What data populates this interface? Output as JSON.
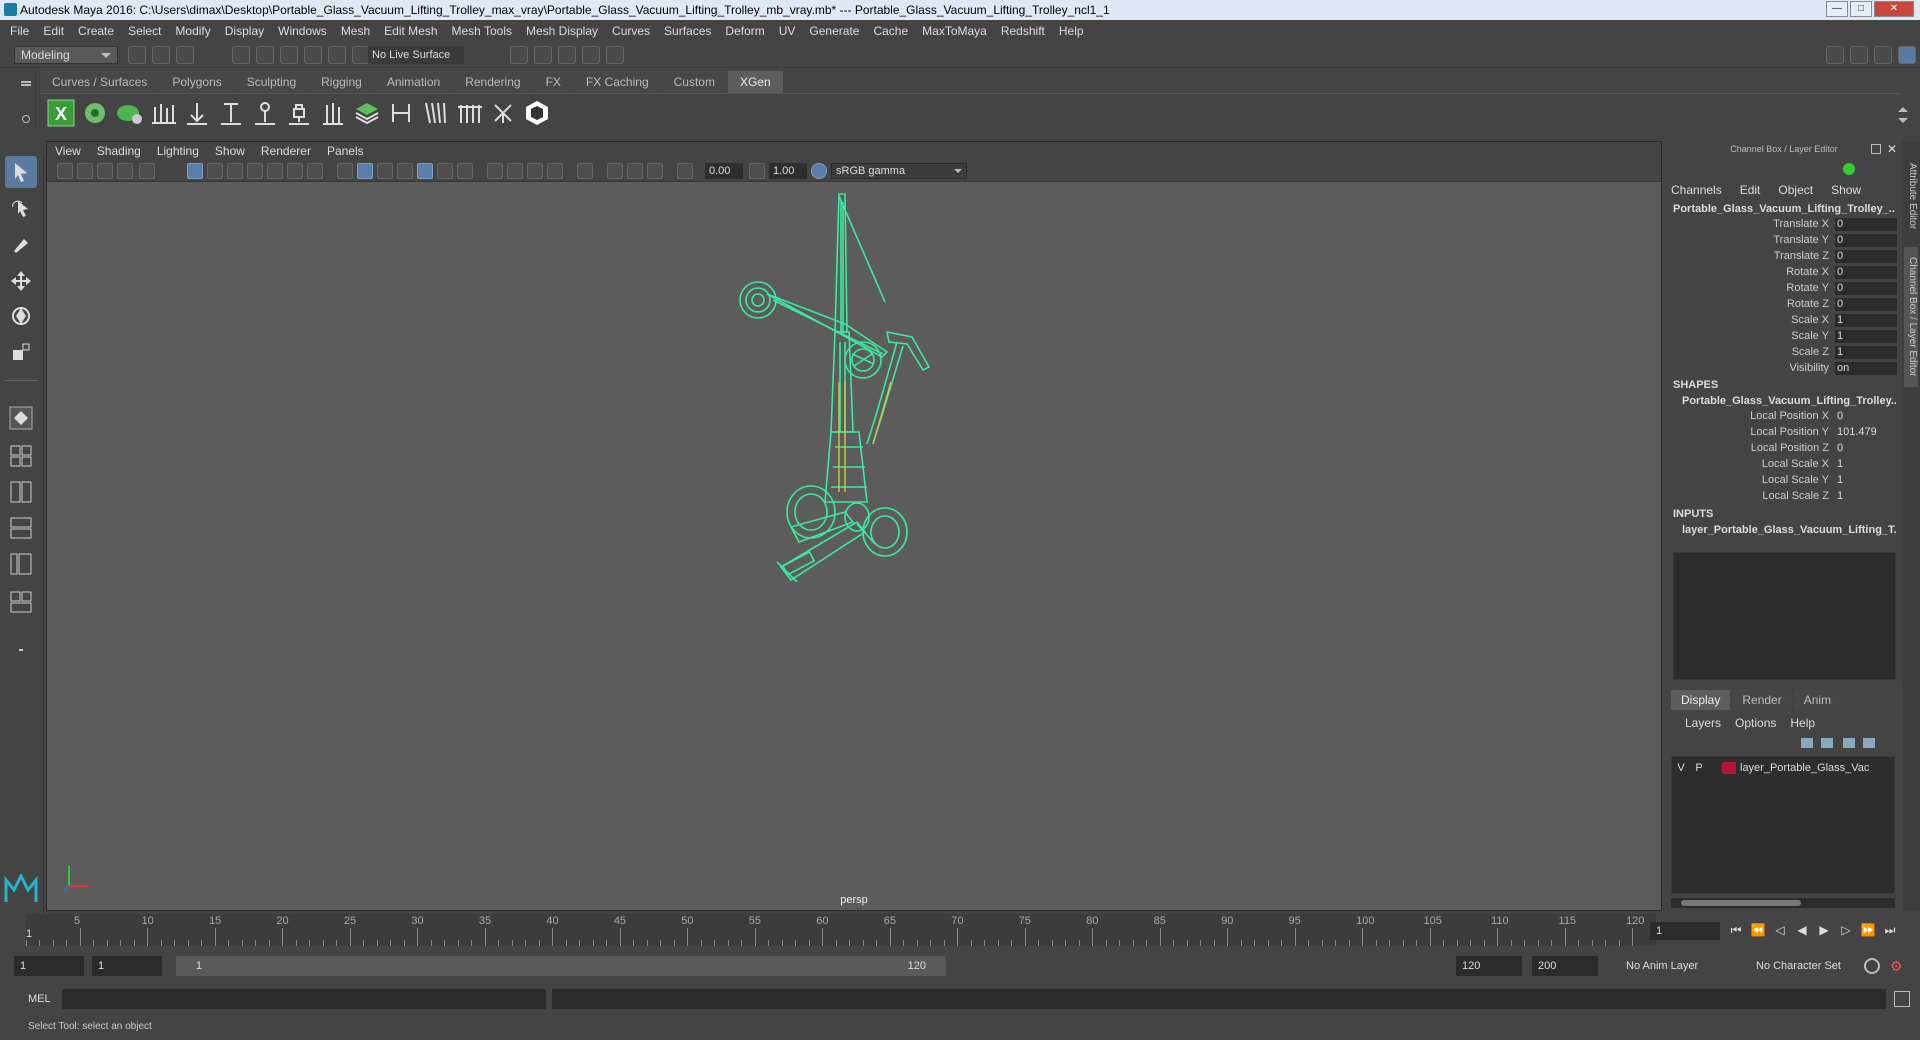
{
  "window": {
    "title": "Autodesk Maya 2016: C:\\Users\\dimax\\Desktop\\Portable_Glass_Vacuum_Lifting_Trolley_max_vray\\Portable_Glass_Vacuum_Lifting_Trolley_mb_vray.mb*   ---   Portable_Glass_Vacuum_Lifting_Trolley_ncl1_1",
    "controls": {
      "minimize": "—",
      "maximize": "□",
      "close": "✕"
    }
  },
  "menubar": [
    "File",
    "Edit",
    "Create",
    "Select",
    "Modify",
    "Display",
    "Windows",
    "Mesh",
    "Edit Mesh",
    "Mesh Tools",
    "Mesh Display",
    "Curves",
    "Surfaces",
    "Deform",
    "UV",
    "Generate",
    "Cache",
    "MaxToMaya",
    "Redshift",
    "Help"
  ],
  "statusline": {
    "mode": "Modeling",
    "live_surface": "No Live Surface"
  },
  "shelf": {
    "tabs": [
      "Curves / Surfaces",
      "Polygons",
      "Sculpting",
      "Rigging",
      "Animation",
      "Rendering",
      "FX",
      "FX Caching",
      "Custom",
      "XGen"
    ],
    "active": "XGen"
  },
  "viewport": {
    "menu": [
      "View",
      "Shading",
      "Lighting",
      "Show",
      "Renderer",
      "Panels"
    ],
    "exposure": "0.00",
    "gamma": "1.00",
    "colorspace": "sRGB gamma",
    "camera": "persp"
  },
  "channel_box": {
    "title": "Channel Box / Layer Editor",
    "menu": [
      "Channels",
      "Edit",
      "Object",
      "Show"
    ],
    "object": "Portable_Glass_Vacuum_Lifting_Trolley_...",
    "attributes": [
      {
        "label": "Translate X",
        "value": "0"
      },
      {
        "label": "Translate Y",
        "value": "0"
      },
      {
        "label": "Translate Z",
        "value": "0"
      },
      {
        "label": "Rotate X",
        "value": "0"
      },
      {
        "label": "Rotate Y",
        "value": "0"
      },
      {
        "label": "Rotate Z",
        "value": "0"
      },
      {
        "label": "Scale X",
        "value": "1"
      },
      {
        "label": "Scale Y",
        "value": "1"
      },
      {
        "label": "Scale Z",
        "value": "1"
      },
      {
        "label": "Visibility",
        "value": "on"
      }
    ],
    "shapes_header": "SHAPES",
    "shape_name": "Portable_Glass_Vacuum_Lifting_Trolley...",
    "shape_attributes": [
      {
        "label": "Local Position X",
        "value": "0"
      },
      {
        "label": "Local Position Y",
        "value": "101.479"
      },
      {
        "label": "Local Position Z",
        "value": "0"
      },
      {
        "label": "Local Scale X",
        "value": "1"
      },
      {
        "label": "Local Scale Y",
        "value": "1"
      },
      {
        "label": "Local Scale Z",
        "value": "1"
      }
    ],
    "inputs_header": "INPUTS",
    "input_name": "layer_Portable_Glass_Vacuum_Lifting_T..."
  },
  "side_tabs": {
    "attribute_editor": "Attribute Editor",
    "channel_box": "Channel Box / Layer Editor"
  },
  "layer_editor": {
    "tabs": [
      "Display",
      "Render",
      "Anim"
    ],
    "active": "Display",
    "menu": [
      "Layers",
      "Options",
      "Help"
    ],
    "layer": {
      "v": "V",
      "p": "P",
      "name": "layer_Portable_Glass_Vac",
      "color": "#b2183a"
    }
  },
  "timeline": {
    "ticks": [
      "5",
      "10",
      "15",
      "20",
      "25",
      "30",
      "35",
      "40",
      "45",
      "50",
      "55",
      "60",
      "65",
      "70",
      "75",
      "80",
      "85",
      "90",
      "95",
      "100",
      "105",
      "110",
      "115",
      "120"
    ],
    "start_marker": "1",
    "current_frame": "1"
  },
  "range": {
    "start": "1",
    "playback_start": "1",
    "slider_start": "1",
    "slider_end": "120",
    "playback_end": "120",
    "end": "200",
    "anim_layer": "No Anim Layer",
    "character_set": "No Character Set"
  },
  "mel": {
    "label": "MEL"
  },
  "help_line": "Select Tool: select an object",
  "colors": {
    "wire": "#3de8a0",
    "selected_wire": "#c8c840",
    "accent": "#5b7aa0"
  }
}
